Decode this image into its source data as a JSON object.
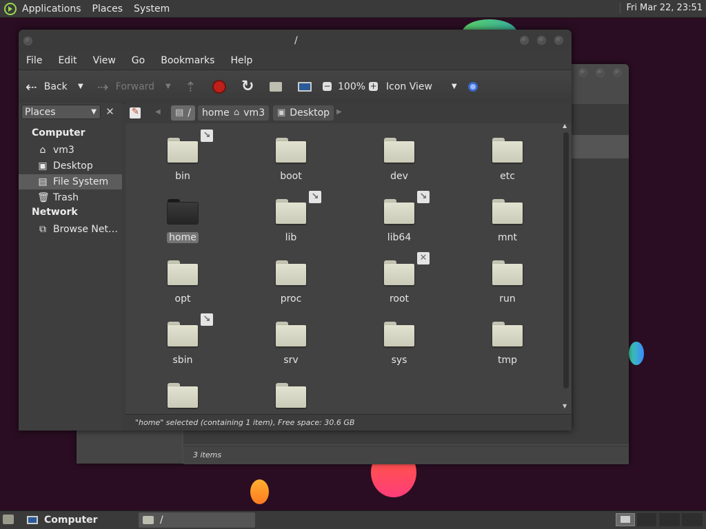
{
  "top_panel": {
    "menus": [
      "Applications",
      "Places",
      "System"
    ],
    "clock": "Fri Mar 22, 23:51"
  },
  "window": {
    "title": "/",
    "menus": [
      "File",
      "Edit",
      "View",
      "Go",
      "Bookmarks",
      "Help"
    ],
    "toolbar": {
      "back": "Back",
      "forward": "Forward",
      "zoom": "100%",
      "view_mode": "Icon View"
    },
    "sidebar": {
      "dropdown": "Places",
      "close_glyph": "✕",
      "sections": [
        {
          "title": "Computer",
          "items": [
            "vm3",
            "Desktop",
            "File System",
            "Trash"
          ]
        },
        {
          "title": "Network",
          "items": [
            "Browse Net…"
          ]
        }
      ],
      "selected": "File System"
    },
    "pathbar": [
      "/",
      "home",
      "vm3",
      "Desktop"
    ],
    "files": [
      {
        "name": "bin",
        "emblem": "link"
      },
      {
        "name": "boot"
      },
      {
        "name": "dev"
      },
      {
        "name": "etc"
      },
      {
        "name": "home",
        "selected": true,
        "dark": true
      },
      {
        "name": "lib",
        "emblem": "link"
      },
      {
        "name": "lib64",
        "emblem": "link"
      },
      {
        "name": "mnt"
      },
      {
        "name": "opt"
      },
      {
        "name": "proc"
      },
      {
        "name": "root",
        "emblem": "locked"
      },
      {
        "name": "run"
      },
      {
        "name": "sbin",
        "emblem": "link"
      },
      {
        "name": "srv"
      },
      {
        "name": "sys"
      },
      {
        "name": "tmp"
      },
      {
        "name": ""
      },
      {
        "name": ""
      }
    ],
    "status": "\"home\" selected (containing 1 item), Free space: 30.6 GB"
  },
  "background_window": {
    "status": "3 items"
  },
  "taskbar": {
    "tasks": [
      "Computer",
      "/"
    ]
  },
  "colors": {
    "desktop": "#2a0d22",
    "panel": "#3a3a3a",
    "folder": "#d6d6c4"
  }
}
